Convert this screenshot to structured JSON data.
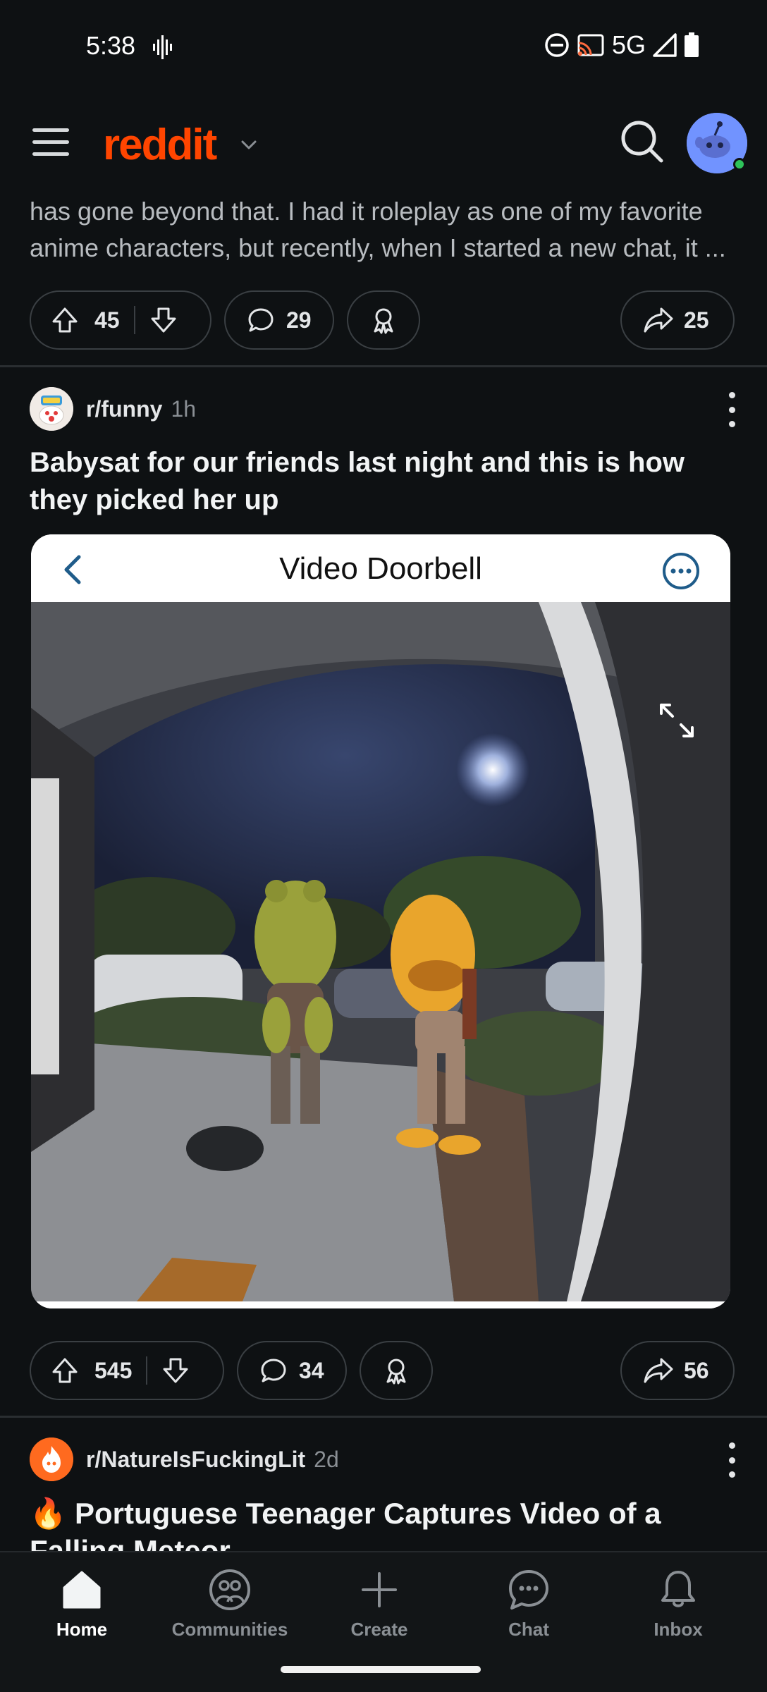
{
  "status_bar": {
    "time": "5:38",
    "network": "5G",
    "icons": [
      "vibrate-wave-icon",
      "do-not-disturb-icon",
      "cast-icon",
      "signal-icon",
      "battery-icon"
    ]
  },
  "header": {
    "logo": "reddit",
    "icons": [
      "menu-icon",
      "chevron-down-icon",
      "search-icon",
      "avatar"
    ]
  },
  "posts": [
    {
      "snippet": "has gone beyond that. I had it roleplay as one of my favorite anime characters, but recently, when I started a new chat, it ...",
      "upvotes": "45",
      "comments": "29",
      "shares": "25"
    },
    {
      "subreddit": "r/funny",
      "time": "1h",
      "title": "Babysat for our friends last night and this is how they picked her up",
      "media": {
        "header_title": "Video Doorbell"
      },
      "upvotes": "545",
      "comments": "34",
      "shares": "56"
    },
    {
      "subreddit": "r/NatureIsFuckingLit",
      "time": "2d",
      "title": "🔥 Portuguese Teenager Captures Video of a Falling Meteor"
    }
  ],
  "nav": [
    {
      "label": "Home",
      "icon": "home-icon",
      "active": true
    },
    {
      "label": "Communities",
      "icon": "communities-icon",
      "active": false
    },
    {
      "label": "Create",
      "icon": "plus-icon",
      "active": false
    },
    {
      "label": "Chat",
      "icon": "chat-icon",
      "active": false
    },
    {
      "label": "Inbox",
      "icon": "bell-icon",
      "active": false
    }
  ],
  "colors": {
    "background": "#0e1113",
    "brand": "#ff4500",
    "text": "#d7dadc",
    "muted": "#8a8f94",
    "avatar_bg": "#7193ff",
    "online": "#2ec35a"
  }
}
